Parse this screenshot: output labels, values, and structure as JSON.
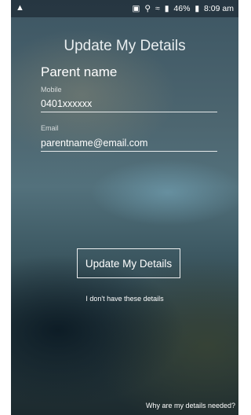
{
  "statusbar": {
    "left_icon": "notification-icon",
    "icons": [
      "sim-icon",
      "location-icon",
      "wifi-icon",
      "signal-icon"
    ],
    "battery": "46%",
    "time": "8:09 am"
  },
  "page": {
    "title": "Update My Details",
    "parent_name": "Parent name"
  },
  "form": {
    "mobile_label": "Mobile",
    "mobile_value": "0401xxxxxx",
    "email_label": "Email",
    "email_value": "parentname@email.com"
  },
  "actions": {
    "update_button": "Update My Details",
    "no_details_link": "I don't have these details",
    "why_link": "Why are my details needed?"
  },
  "colors": {
    "text": "#ffffff",
    "background": "#3e5a64"
  }
}
